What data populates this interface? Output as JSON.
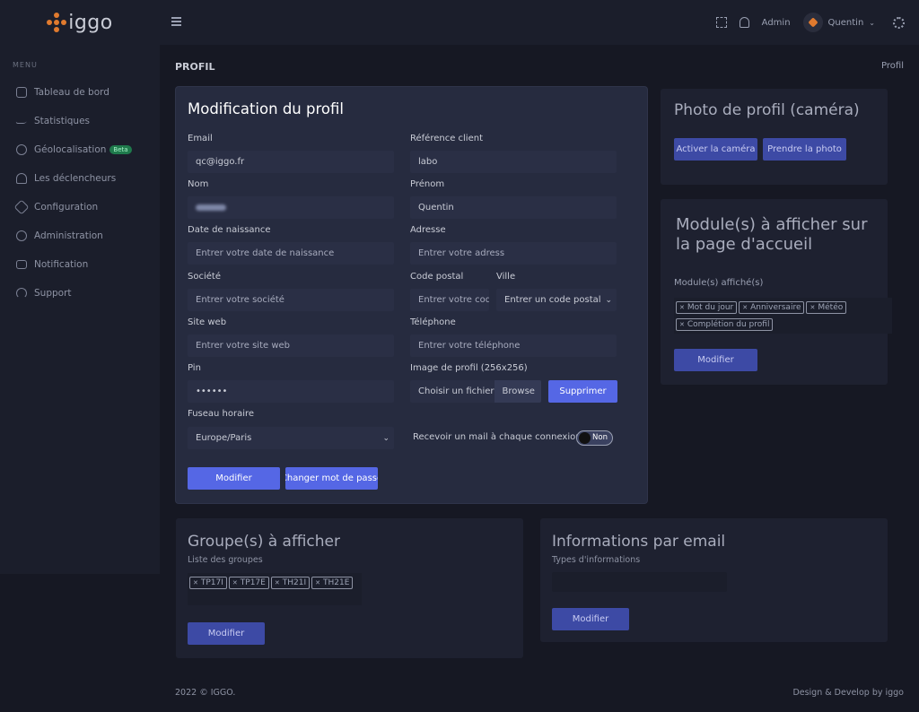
{
  "brand": {
    "logo_text": "iggo"
  },
  "sidebar": {
    "menu_title": "MENU",
    "items": [
      {
        "label": "Tableau de bord",
        "icon": "home-icon"
      },
      {
        "label": "Statistiques",
        "icon": "chart-icon"
      },
      {
        "label": "Géolocalisation",
        "icon": "location-icon",
        "badge": "Beta"
      },
      {
        "label": "Les déclencheurs",
        "icon": "bell-icon"
      },
      {
        "label": "Configuration",
        "icon": "wrench-icon"
      },
      {
        "label": "Administration",
        "icon": "user-circle-icon"
      },
      {
        "label": "Notification",
        "icon": "mail-icon"
      },
      {
        "label": "Support",
        "icon": "headset-icon"
      }
    ]
  },
  "topbar": {
    "admin_label": "Admin",
    "user_name": "Quentin"
  },
  "page": {
    "title": "PROFIL",
    "breadcrumb": "Profil"
  },
  "profile_form": {
    "title": "Modification du profil",
    "email_label": "Email",
    "email_value": "qc@iggo.fr",
    "ref_label": "Référence client",
    "ref_value": "labo",
    "nom_label": "Nom",
    "prenom_label": "Prénom",
    "prenom_value": "Quentin",
    "dob_label": "Date de naissance",
    "dob_placeholder": "Entrer votre date de naissance",
    "adresse_label": "Adresse",
    "adresse_placeholder": "Entrer votre adress",
    "societe_label": "Société",
    "societe_placeholder": "Entrer votre société",
    "cp_label": "Code postal",
    "cp_placeholder": "Entrer votre code postal",
    "ville_label": "Ville",
    "ville_value": "Entrer un code postal",
    "site_label": "Site web",
    "site_placeholder": "Entrer votre site web",
    "tel_label": "Téléphone",
    "tel_placeholder": "Entrer votre téléphone",
    "pin_label": "Pin",
    "pin_value": "••••••",
    "image_label": "Image de profil (256x256)",
    "file_choose": "Choisir un fichier",
    "file_browse": "Browse",
    "delete_btn": "Supprimer",
    "tz_label": "Fuseau horaire",
    "tz_value": "Europe/Paris",
    "mail_toggle_label": "Recevoir un mail à chaque connexion",
    "mail_toggle_state": "Non",
    "modify_btn": "Modifier",
    "change_pwd_btn": "Changer mot de passe"
  },
  "photo_card": {
    "title": "Photo de profil (caméra)",
    "activate_btn": "Activer la caméra",
    "capture_btn": "Prendre la photo"
  },
  "modules_card": {
    "title": "Module(s) à afficher sur la page d'accueil",
    "label": "Module(s) affiché(s)",
    "tags": [
      "Mot du jour",
      "Anniversaire",
      "Météo",
      "Complétion du profil"
    ],
    "modify_btn": "Modifier"
  },
  "groups_card": {
    "title": "Groupe(s) à afficher",
    "label": "Liste des groupes",
    "tags": [
      "TP17I",
      "TP17E",
      "TH21I",
      "TH21E"
    ],
    "modify_btn": "Modifier"
  },
  "email_card": {
    "title": "Informations par email",
    "label": "Types d'informations",
    "modify_btn": "Modifier"
  },
  "footer": {
    "left": "2022 © IGGO.",
    "right": "Design & Develop by iggo"
  }
}
